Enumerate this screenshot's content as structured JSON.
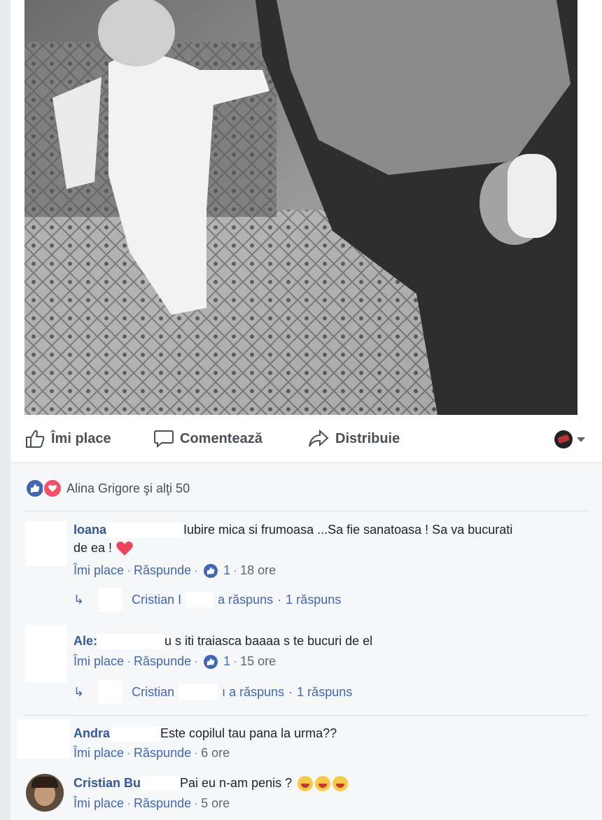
{
  "actions": {
    "like": "Îmi place",
    "comment": "Comentează",
    "share": "Distribuie"
  },
  "reactions": {
    "summary": "Alina Grigore şi alţi 50"
  },
  "comments": [
    {
      "name": "Ioana",
      "text": "Iubire mica si frumoasa ...Sa fie sanatoasa ! Sa va bucurati",
      "text2": "de ea !",
      "like": "Îmi place",
      "reply": "Răspunde",
      "likes": "1",
      "time": "18 ore",
      "reply_by": "Cristian I",
      "reply_verb": "a răspuns",
      "reply_count": "1 răspuns"
    },
    {
      "name": "Ale:",
      "text": "u s iti traiasca baaaa s te bucuri de el",
      "like": "Îmi place",
      "reply": "Răspunde",
      "likes": "1",
      "time": "15 ore",
      "reply_by": "Cristian",
      "reply_verb": "ı a răspuns",
      "reply_count": "1 răspuns"
    },
    {
      "name": "Andra",
      "text": "Este copilul tau pana la urma??",
      "like": "Îmi place",
      "reply": "Răspunde",
      "time": "6 ore"
    },
    {
      "name": "Cristian Bu",
      "text": "Pai eu n-am penis ?",
      "like": "Îmi place",
      "reply": "Răspunde",
      "time": "5 ore"
    }
  ],
  "separator": "·",
  "colors": {
    "link": "#4267b2",
    "name": "#365899",
    "like_blue": "#4267b2",
    "love": "#f25268"
  }
}
